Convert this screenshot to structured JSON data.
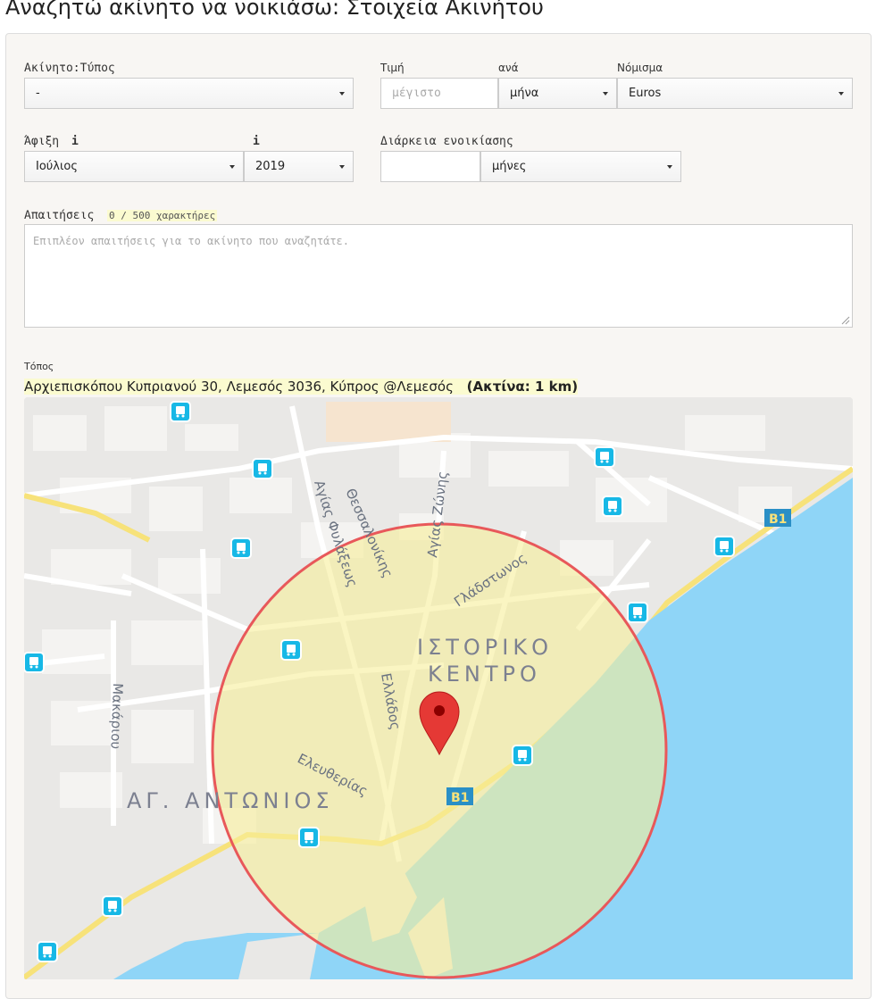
{
  "page_title": "Αναζητώ ακίνητο να νοικιάσω: Στοιχεία Ακινήτου",
  "property_type": {
    "label": "Ακίνητο:Τύπος",
    "value": "-"
  },
  "price": {
    "label": "Τιμή",
    "placeholder": "μέγιστο",
    "per_label": "ανά",
    "per_value": "μήνα",
    "currency_label": "Νόμισμα",
    "currency_value": "Euros"
  },
  "arrival": {
    "label": "Άφιξη",
    "info": "i",
    "month": "Ιούλιος",
    "year_info": "i",
    "year": "2019"
  },
  "duration": {
    "label": "Διάρκεια ενοικίασης",
    "value": "",
    "unit": "μήνες"
  },
  "requirements": {
    "label": "Απαιτήσεις",
    "counter": "0 / 500 χαρακτήρες",
    "placeholder": "Επιπλέον απαιτήσεις για το ακίνητο που αναζητάτε."
  },
  "location": {
    "label": "Τόπος",
    "address": "Αρχιεπισκόπου Κυπριανού 30, Λεμεσός 3036, Κύπρος @Λεμεσός",
    "radius": "(Ακτίνα: 1 km)"
  },
  "map": {
    "streets": [
      "Αγίας Φυλάξεως",
      "Θεσσαλονίκης",
      "Αγίας Ζώνης",
      "Γλάδστωνος",
      "Ελλάδος",
      "Μακάριου",
      "Ελευθερίας"
    ],
    "districts": [
      "ΙΣΤΟΡΙΚΟ",
      "ΚΕΝΤΡΟ",
      "ΑΓ. ΑΝΤΩΝΙΟΣ"
    ],
    "road_badge": "B1",
    "colors": {
      "sea": "#8fd5f7",
      "land": "#e9e8e6",
      "road": "#f7e27a",
      "circle_fill": "#f7ef9a",
      "circle_stroke": "#e8585a",
      "marker": "#e53935",
      "bus": "#17b8e6"
    }
  }
}
